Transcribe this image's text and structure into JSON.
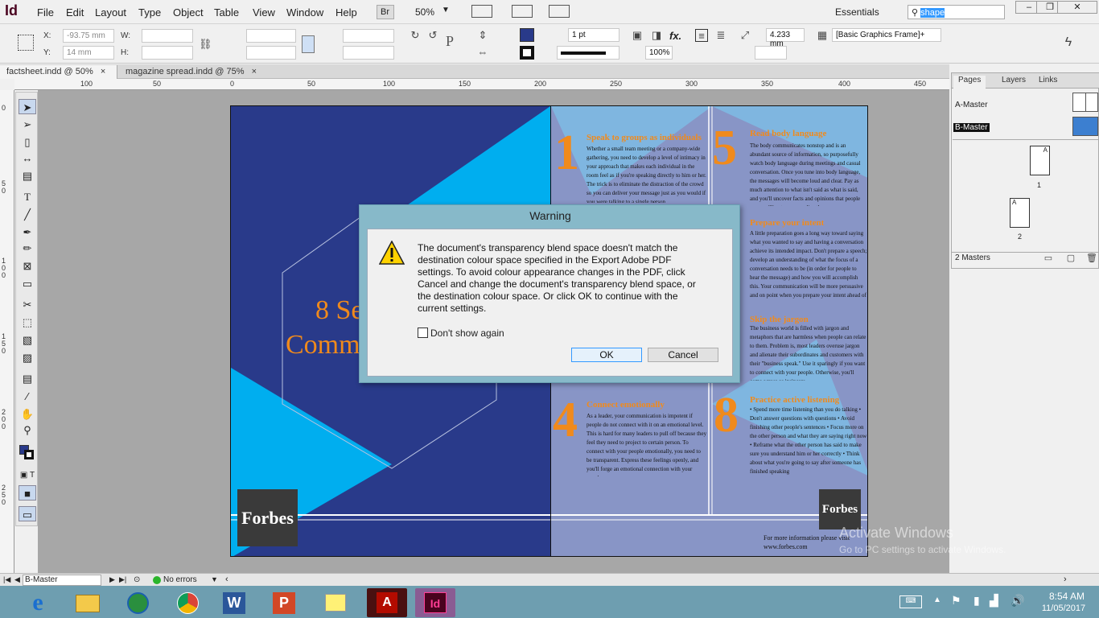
{
  "app": {
    "logo": "Id",
    "bridge": "Br",
    "zoom": "50%",
    "workspace": "Essentials",
    "search_value": "shape"
  },
  "menu": [
    "File",
    "Edit",
    "Layout",
    "Type",
    "Object",
    "Table",
    "View",
    "Window",
    "Help"
  ],
  "control": {
    "x_label": "X:",
    "x_value": "-93.75 mm",
    "y_label": "Y:",
    "y_value": "14 mm",
    "w_label": "W:",
    "h_label": "H:",
    "stroke_weight": "1 pt",
    "dimension": "4.233 mm",
    "scale": "100%",
    "object_style": "[Basic Graphics Frame]+"
  },
  "tabs": [
    {
      "label": "factsheet.indd @ 50%",
      "close": "×"
    },
    {
      "label": "magazine spread.indd @ 75%",
      "close": "×"
    }
  ],
  "ruler": {
    "h": [
      "100",
      "50",
      "0",
      "50",
      "100",
      "150",
      "200",
      "250",
      "300",
      "350",
      "400",
      "450"
    ],
    "v": [
      "0",
      "50",
      "100",
      "150",
      "200",
      "250"
    ]
  },
  "document": {
    "left_title_1": "8 Se",
    "left_title_2": "Comm",
    "forbes": "Forbes",
    "sections": [
      {
        "num": "1",
        "head": "Speak to groups as individuals",
        "text": "Whether a small team meeting or a company-wide gathering, you need to develop a level of intimacy in your approach that makes each individual in the room feel as if you're speaking directly to him or her. The trick is to eliminate the distraction of the crowd so you can deliver your message just as you would if you were talking to a single person."
      },
      {
        "num": "5",
        "head": "Read body language",
        "text": "The body communicates nonstop and is an abundant source of information, so purposefully watch body language during meetings and casual conversation. Once you tune into body language, the messages will become loud and clear. Pay as much attention to what isn't said as what is said, and you'll uncover facts and opinions that people are unwilling to express directly."
      },
      {
        "num": "",
        "head": "Prepare your intent",
        "text": "A little preparation goes a long way toward saying what you wanted to say and having a conversation achieve its intended impact. Don't prepare a speech; develop an understanding of what the focus of a conversation needs to be (in order for people to hear the message) and how you will accomplish this. Your communication will be more persuasive and on point when you prepare your intent ahead of time."
      },
      {
        "num": "",
        "head": "Skip the jargon",
        "text": "The business world is filled with jargon and metaphors that are harmless when people can relate to them. Problem is, most leaders overuse jargon and alienate their subordinates and customers with their \"business speak.\" Use it sparingly if you want to connect with your people. Otherwise, you'll come across as insincere."
      },
      {
        "num": "4",
        "head": "Connect emotionally",
        "text": "As a leader, your communication is impotent if people do not connect with it on an emotional level. This is hard for many leaders to pull off because they feel they need to project to certain person. To connect with your people emotionally, you need to be transparent. Express these feelings openly, and you'll forge an emotional connection with your people."
      },
      {
        "num": "8",
        "head": "Practice active listening",
        "text": "• Spend more time listening than you do talking • Don't answer questions with questions • Avoid finishing other people's sentences • Focus more on the other person and what they are saying right now • Reframe what the other person has said to make sure you understand him or her correctly • Think about what you're going to say after someone has finished speaking"
      }
    ],
    "footer_1": "For more information please visit",
    "footer_2": "www.forbes.com"
  },
  "dialog": {
    "title": "Warning",
    "message": "The document's transparency blend space doesn't match the destination colour space specified in the Export Adobe PDF settings. To avoid colour appearance changes in the PDF, click Cancel and change the document's transparency blend space, or the destination colour space. Or click OK to continue with the current settings.",
    "checkbox": "Don't show again",
    "checkbox_checked": false,
    "ok": "OK",
    "cancel": "Cancel"
  },
  "panel": {
    "tabs": [
      "Pages",
      "Layers",
      "Links"
    ],
    "masters": [
      "A-Master",
      "B-Master"
    ],
    "page_1": "1",
    "page_2": "2",
    "page_prefix": "A",
    "footer": "2 Masters"
  },
  "status": {
    "page": "B-Master",
    "preflight": "No errors"
  },
  "watermark": {
    "line1": "Activate Windows",
    "line2": "Go to PC settings to activate Windows."
  },
  "clock": {
    "time": "8:54 AM",
    "date": "11/05/2017"
  },
  "colors": {
    "accent_orange": "#f08a1c",
    "navy": "#293a8a",
    "cyan": "#00aeef",
    "taskbar": "#6e9eb0"
  }
}
